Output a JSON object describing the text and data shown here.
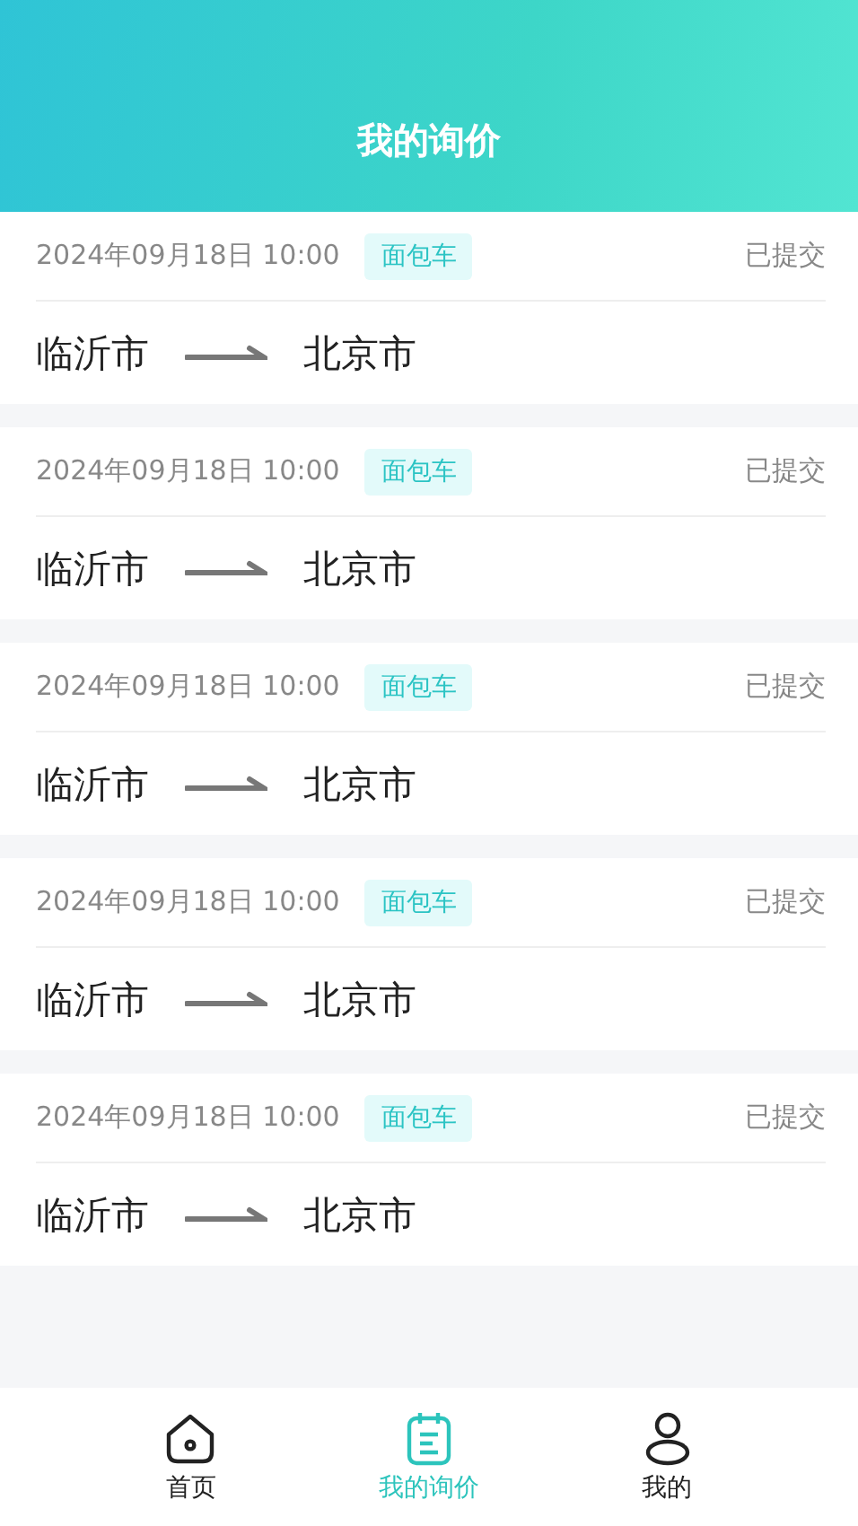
{
  "header": {
    "title": "我的询价"
  },
  "inquiries": [
    {
      "time": "2024年09月18日 10:00",
      "vehicle": "面包车",
      "status": "已提交",
      "from": "临沂市",
      "to": "北京市"
    },
    {
      "time": "2024年09月18日 10:00",
      "vehicle": "面包车",
      "status": "已提交",
      "from": "临沂市",
      "to": "北京市"
    },
    {
      "time": "2024年09月18日 10:00",
      "vehicle": "面包车",
      "status": "已提交",
      "from": "临沂市",
      "to": "北京市"
    },
    {
      "time": "2024年09月18日 10:00",
      "vehicle": "面包车",
      "status": "已提交",
      "from": "临沂市",
      "to": "北京市"
    },
    {
      "time": "2024年09月18日 10:00",
      "vehicle": "面包车",
      "status": "已提交",
      "from": "临沂市",
      "to": "北京市"
    }
  ],
  "tab_bar": [
    {
      "label": "首页",
      "kind": "home",
      "selected": false
    },
    {
      "label": "我的询价",
      "kind": "inquiry",
      "selected": true
    },
    {
      "label": "我的",
      "kind": "profile",
      "selected": false
    }
  ]
}
